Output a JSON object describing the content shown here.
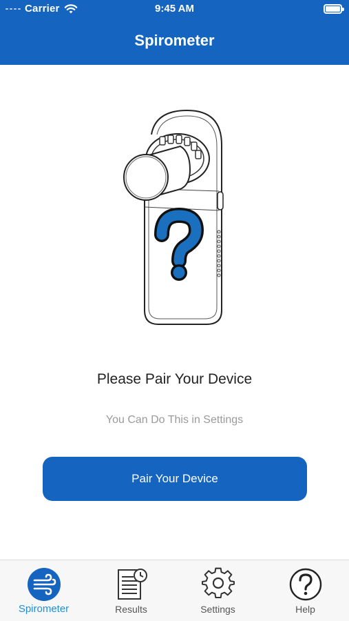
{
  "status_bar": {
    "carrier": "Carrier",
    "time": "9:45 AM"
  },
  "header": {
    "title": "Spirometer"
  },
  "main": {
    "heading": "Please Pair Your Device",
    "subtext": "You Can Do This in Settings",
    "pair_button_label": "Pair Your Device"
  },
  "tabs": [
    {
      "label": "Spirometer",
      "icon": "airflow-icon",
      "active": true
    },
    {
      "label": "Results",
      "icon": "results-document-icon",
      "active": false
    },
    {
      "label": "Settings",
      "icon": "gear-icon",
      "active": false
    },
    {
      "label": "Help",
      "icon": "help-icon",
      "active": false
    }
  ],
  "colors": {
    "primary": "#1565c0",
    "active_tab": "#1f8fd6",
    "question_mark": "#1a6fbf"
  }
}
